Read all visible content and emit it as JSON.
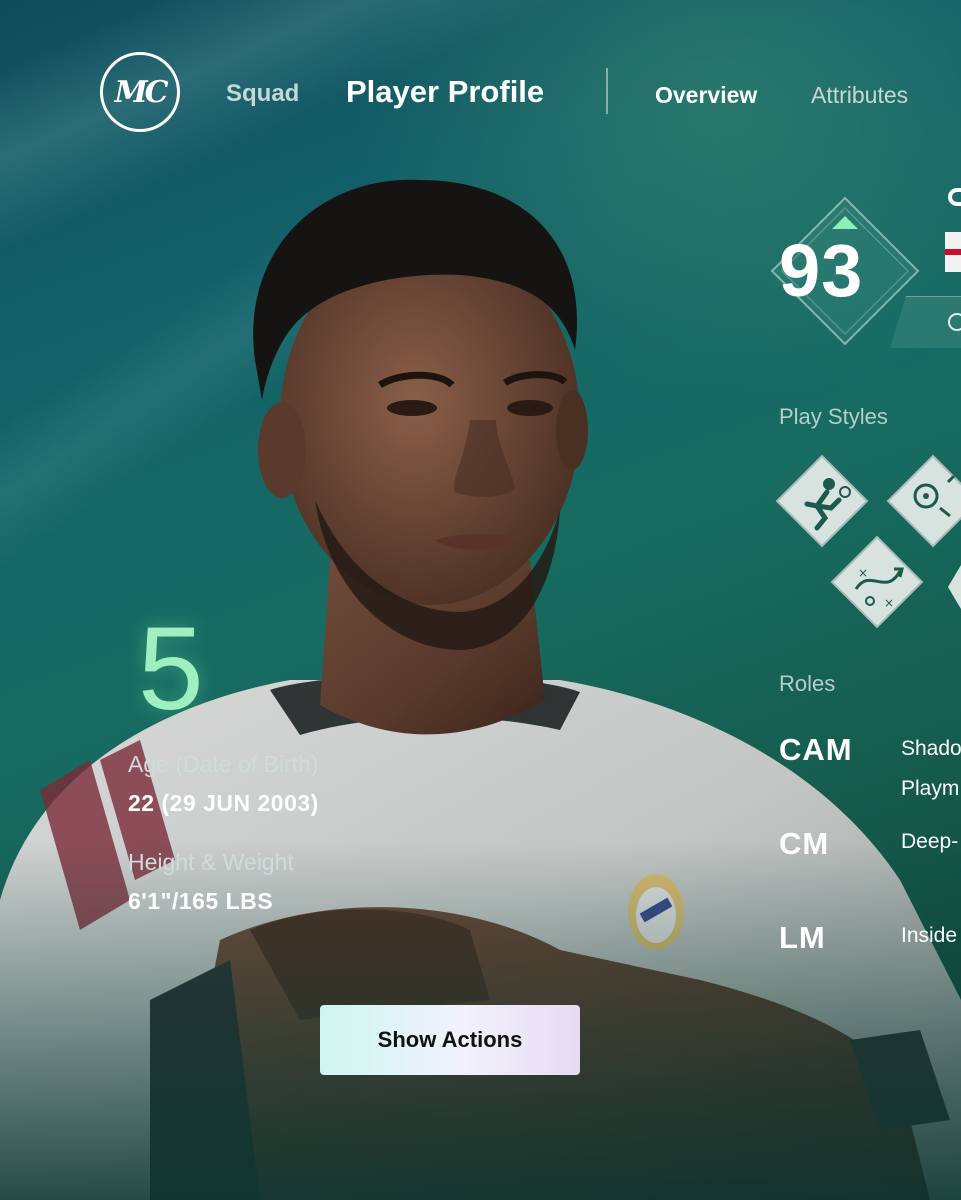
{
  "header": {
    "logo_text": "MC",
    "nav_squad": "Squad",
    "page_title": "Player Profile",
    "tabs": [
      {
        "label": "Overview",
        "active": true
      },
      {
        "label": "Attributes",
        "active": false
      }
    ]
  },
  "player": {
    "jersey_number": "5",
    "rating": "93",
    "rating_trend_icon": "chevron-up-icon",
    "age_label": "Age (Date of Birth)",
    "age_value": "22 (29 JUN 2003)",
    "height_weight_label": "Height & Weight",
    "height_weight_value": "6'1\"/165 LBS",
    "club_crest": "real-madrid-crest"
  },
  "play_styles": {
    "label": "Play Styles",
    "icons": [
      "dribbling-player-icon",
      "ball-control-icon",
      "tactics-board-icon"
    ]
  },
  "roles": {
    "label": "Roles",
    "items": [
      {
        "position": "CAM",
        "names": [
          "Shado",
          "Playm"
        ]
      },
      {
        "position": "CM",
        "names": [
          "Deep-"
        ]
      },
      {
        "position": "LM",
        "names": [
          "Inside"
        ]
      }
    ]
  },
  "actions": {
    "show_actions_label": "Show Actions"
  },
  "colors": {
    "accent_green": "#9ff0c0",
    "bg_teal": "#176c62",
    "button_gradient_start": "#cdf6f0",
    "button_gradient_end": "#e6dbf3"
  }
}
